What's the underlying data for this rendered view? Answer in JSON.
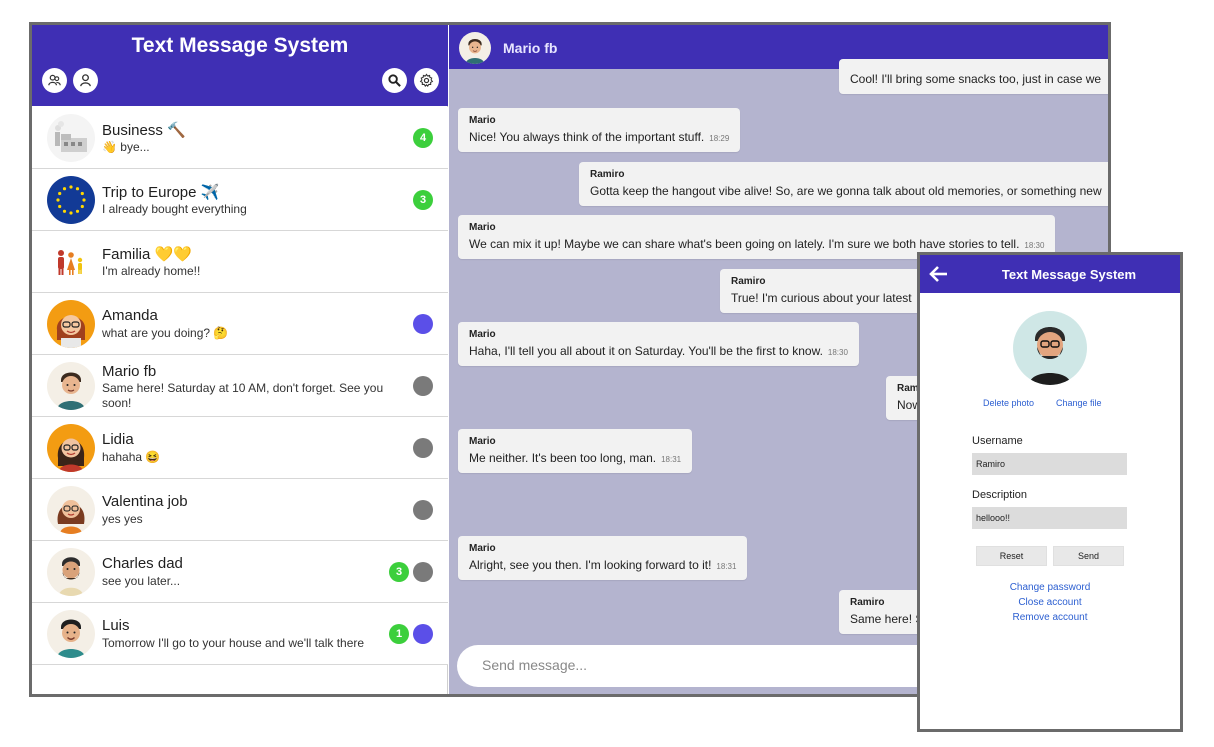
{
  "app": {
    "title": "Text Message System"
  },
  "sidebar_header": {
    "icons": [
      "people-icon",
      "user-icon",
      "search-icon",
      "gear-icon"
    ]
  },
  "chats": [
    {
      "name": "Business 🔨",
      "preview": "👋 bye...",
      "badge": "4",
      "status": ""
    },
    {
      "name": "Trip to Europe ✈️",
      "preview": "I already bought everything",
      "badge": "3",
      "status": ""
    },
    {
      "name": "Familia 💛💛",
      "preview": "I'm already home!!",
      "badge": "",
      "status": ""
    },
    {
      "name": "Amanda",
      "preview": "what are you doing? 🤔",
      "badge": "",
      "status": "#5b4fe8"
    },
    {
      "name": "Mario fb",
      "preview": "Same here! Saturday at 10 AM, don't forget. See you soon!",
      "badge": "",
      "status": "#7a7a7a"
    },
    {
      "name": "Lidia",
      "preview": "hahaha 😆",
      "badge": "",
      "status": "#7a7a7a"
    },
    {
      "name": "Valentina job",
      "preview": "yes yes",
      "badge": "",
      "status": "#7a7a7a"
    },
    {
      "name": "Charles dad",
      "preview": "see you later...",
      "badge": "3",
      "status": "#7a7a7a"
    },
    {
      "name": "Luis",
      "preview": "Tomorrow I'll go to your house and we'll talk there",
      "badge": "1",
      "status": "#5b4fe8"
    }
  ],
  "conversation": {
    "title": "Mario fb",
    "messages": [
      {
        "sender": "Ramiro",
        "text": "Cool! I'll bring some snacks too, just in case we",
        "time": ""
      },
      {
        "sender": "Mario",
        "text": "Nice! You always think of the important stuff.",
        "time": "18:29"
      },
      {
        "sender": "Ramiro",
        "text": "Gotta keep the hangout vibe alive! So, are we gonna talk about old memories, or something new",
        "time": ""
      },
      {
        "sender": "Mario",
        "text": "We can mix it up! Maybe we can share what's been going on lately. I'm sure we both have stories to tell.",
        "time": "18:30"
      },
      {
        "sender": "Ramiro",
        "text": "True! I'm curious about your latest",
        "time": ""
      },
      {
        "sender": "Mario",
        "text": "Haha, I'll tell you all about it on Saturday. You'll be the first to know.",
        "time": "18:30"
      },
      {
        "sender": "Ram",
        "text": "Now",
        "time": ""
      },
      {
        "sender": "Mario",
        "text": "Me neither. It's been too long, man.",
        "time": "18:31"
      },
      {
        "sender": "Mario",
        "text": "Alright, see you then. I'm looking forward to it!",
        "time": "18:31"
      },
      {
        "sender": "Ramiro",
        "text": "Same here! S",
        "time": ""
      }
    ],
    "input_placeholder": "Send message..."
  },
  "profile": {
    "title": "Text Message System",
    "delete_photo": "Delete photo",
    "change_file": "Change file",
    "username_label": "Username",
    "username_value": "Ramiro",
    "description_label": "Description",
    "description_value": "hellooo!!",
    "reset_label": "Reset",
    "send_label": "Send",
    "change_password": "Change password",
    "close_account": "Close account",
    "remove_account": "Remove account"
  },
  "colors": {
    "header": "#3f2fb4",
    "chat_bg": "#b4b4cf",
    "badge_green": "#3ccf3c",
    "online": "#5b4fe8",
    "offline": "#7a7a7a",
    "link": "#2c5fd1"
  }
}
